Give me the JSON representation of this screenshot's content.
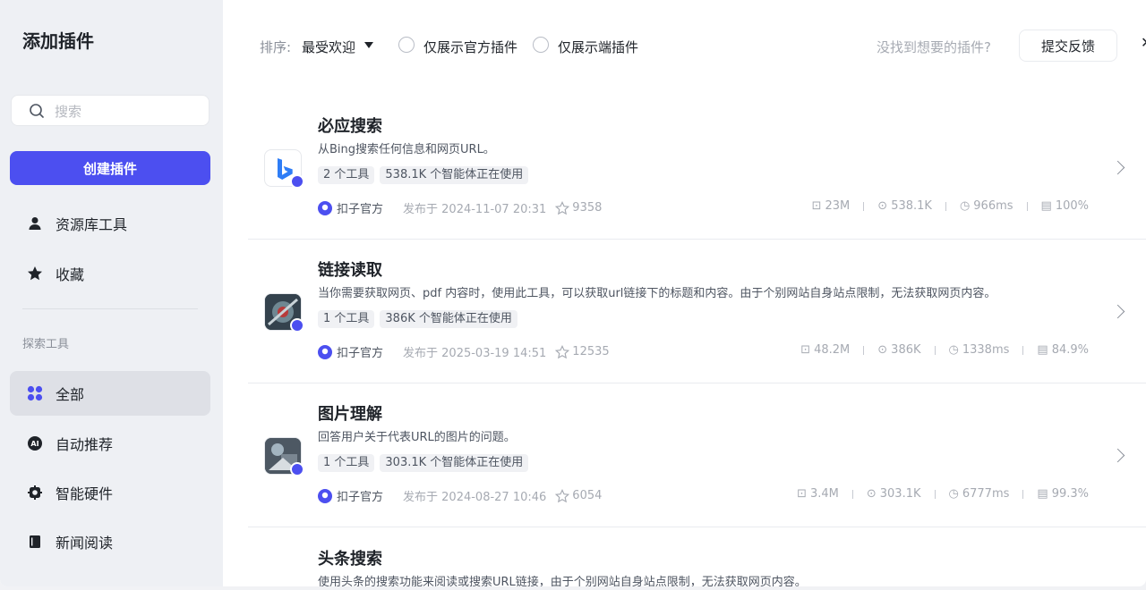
{
  "sidebar": {
    "title": "添加插件",
    "search_placeholder": "搜索",
    "create_label": "创建插件",
    "top_items": [
      {
        "label": "资源库工具",
        "icon": "user-icon"
      },
      {
        "label": "收藏",
        "icon": "star-icon"
      }
    ],
    "section_label": "探索工具",
    "items": [
      {
        "label": "全部",
        "icon": "grid-icon",
        "active": true
      },
      {
        "label": "自动推荐",
        "icon": "ai-icon"
      },
      {
        "label": "智能硬件",
        "icon": "chip-icon"
      },
      {
        "label": "新闻阅读",
        "icon": "book-icon"
      }
    ]
  },
  "toolbar": {
    "sort_label": "排序:",
    "sort_value": "最受欢迎",
    "filter_official": "仅展示官方插件",
    "filter_client": "仅展示端插件",
    "not_found": "没找到想要的插件?",
    "feedback": "提交反馈"
  },
  "plugins": [
    {
      "name": "必应搜索",
      "description": "从Bing搜索任何信息和网页URL。",
      "tools": "2 个工具",
      "usage": "538.1K 个智能体正在使用",
      "org": "扣子官方",
      "published": "发布于 2024-11-07 20:31",
      "stars": "9358",
      "stat_calls": "23M",
      "stat_bots": "538.1K",
      "stat_latency": "966ms",
      "stat_success": "100%"
    },
    {
      "name": "链接读取",
      "description": "当你需要获取网页、pdf 内容时，使用此工具，可以获取url链接下的标题和内容。由于个别网站自身站点限制，无法获取网页内容。",
      "tools": "1 个工具",
      "usage": "386K 个智能体正在使用",
      "org": "扣子官方",
      "published": "发布于 2025-03-19 14:51",
      "stars": "12535",
      "stat_calls": "48.2M",
      "stat_bots": "386K",
      "stat_latency": "1338ms",
      "stat_success": "84.9%"
    },
    {
      "name": "图片理解",
      "description": "回答用户关于代表URL的图片的问题。",
      "tools": "1 个工具",
      "usage": "303.1K 个智能体正在使用",
      "org": "扣子官方",
      "published": "发布于 2024-08-27 10:46",
      "stars": "6054",
      "stat_calls": "3.4M",
      "stat_bots": "303.1K",
      "stat_latency": "6777ms",
      "stat_success": "99.3%"
    },
    {
      "name": "头条搜索",
      "description": "使用头条的搜索功能来阅读或搜索URL链接，由于个别网站自身站点限制，无法获取网页内容。"
    }
  ],
  "colors": {
    "accent": "#4c4ff0",
    "sidebar_bg": "#eef0f4"
  }
}
